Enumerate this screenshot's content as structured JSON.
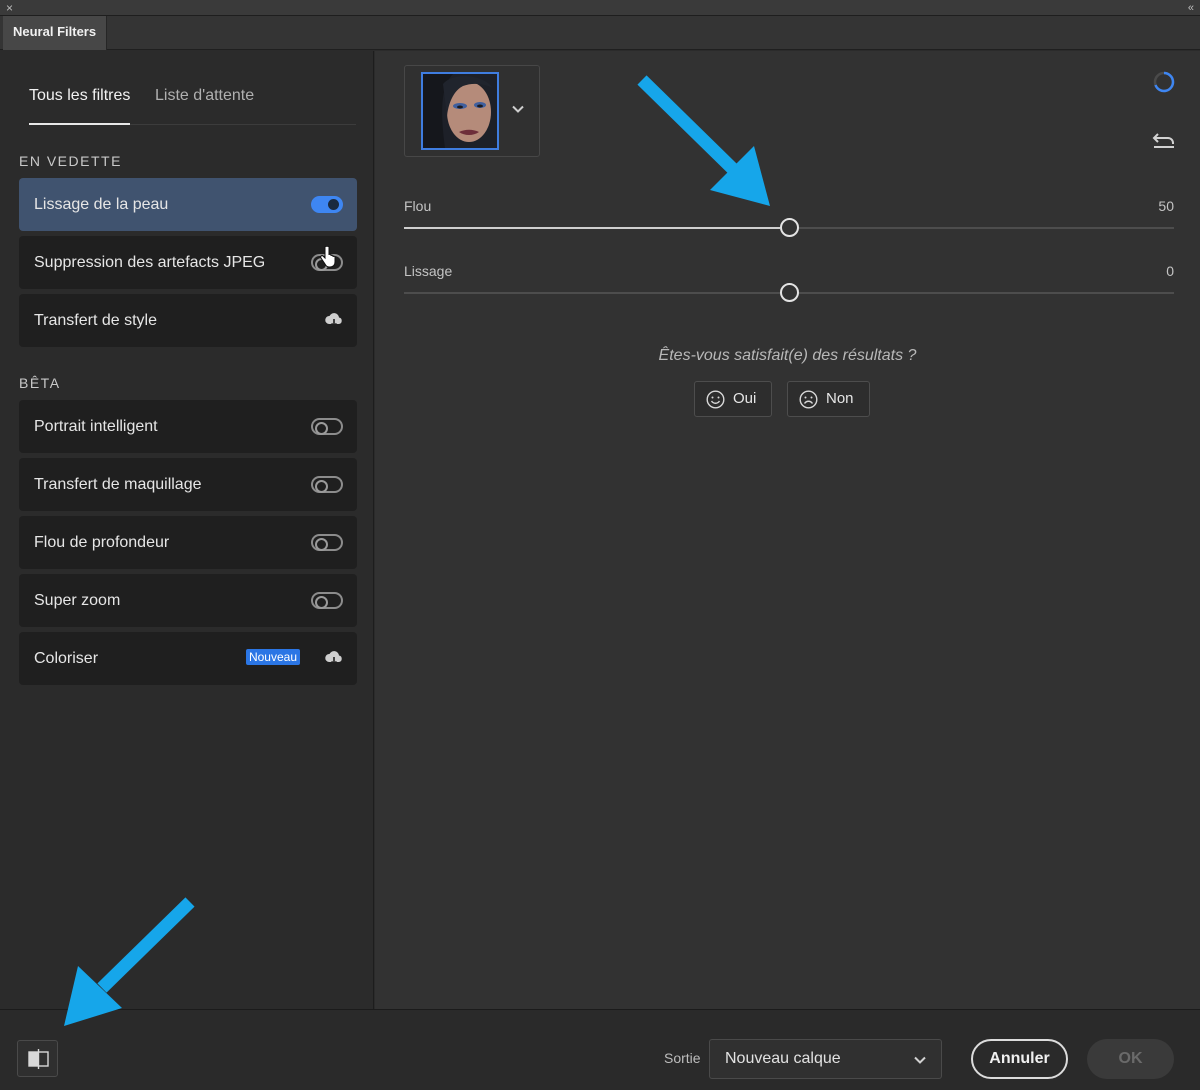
{
  "window": {
    "tab_title": "Neural Filters",
    "close_glyph": "×",
    "collapse_glyph": "«"
  },
  "sidebar": {
    "tabs": [
      {
        "label": "Tous les filtres",
        "active": true
      },
      {
        "label": "Liste d'attente",
        "active": false
      }
    ],
    "sections": {
      "featured": "EN VEDETTE",
      "beta": "BÊTA"
    },
    "featured_items": [
      {
        "label": "Lissage de la peau",
        "state": "on"
      },
      {
        "label": "Suppression des artefacts JPEG",
        "state": "off"
      },
      {
        "label": "Transfert de style",
        "state": "download"
      }
    ],
    "beta_items": [
      {
        "label": "Portrait intelligent",
        "state": "off"
      },
      {
        "label": "Transfert de maquillage",
        "state": "off"
      },
      {
        "label": "Flou de profondeur",
        "state": "off"
      },
      {
        "label": "Super zoom",
        "state": "off"
      },
      {
        "label": "Coloriser",
        "state": "download",
        "badge": "Nouveau"
      }
    ]
  },
  "panel": {
    "sliders": [
      {
        "label": "Flou",
        "value": "50",
        "fraction": 0.5
      },
      {
        "label": "Lissage",
        "value": "0",
        "fraction": 0.5
      }
    ],
    "feedback": {
      "question": "Êtes-vous satisfait(e) des résultats ?",
      "yes": "Oui",
      "no": "Non"
    }
  },
  "footer": {
    "output_label": "Sortie",
    "output_value": "Nouveau calque",
    "cancel": "Annuler",
    "ok": "OK"
  },
  "colors": {
    "accent": "#3e86f2",
    "annotation_arrow": "#16a6ea",
    "active_item": "#40536f"
  }
}
